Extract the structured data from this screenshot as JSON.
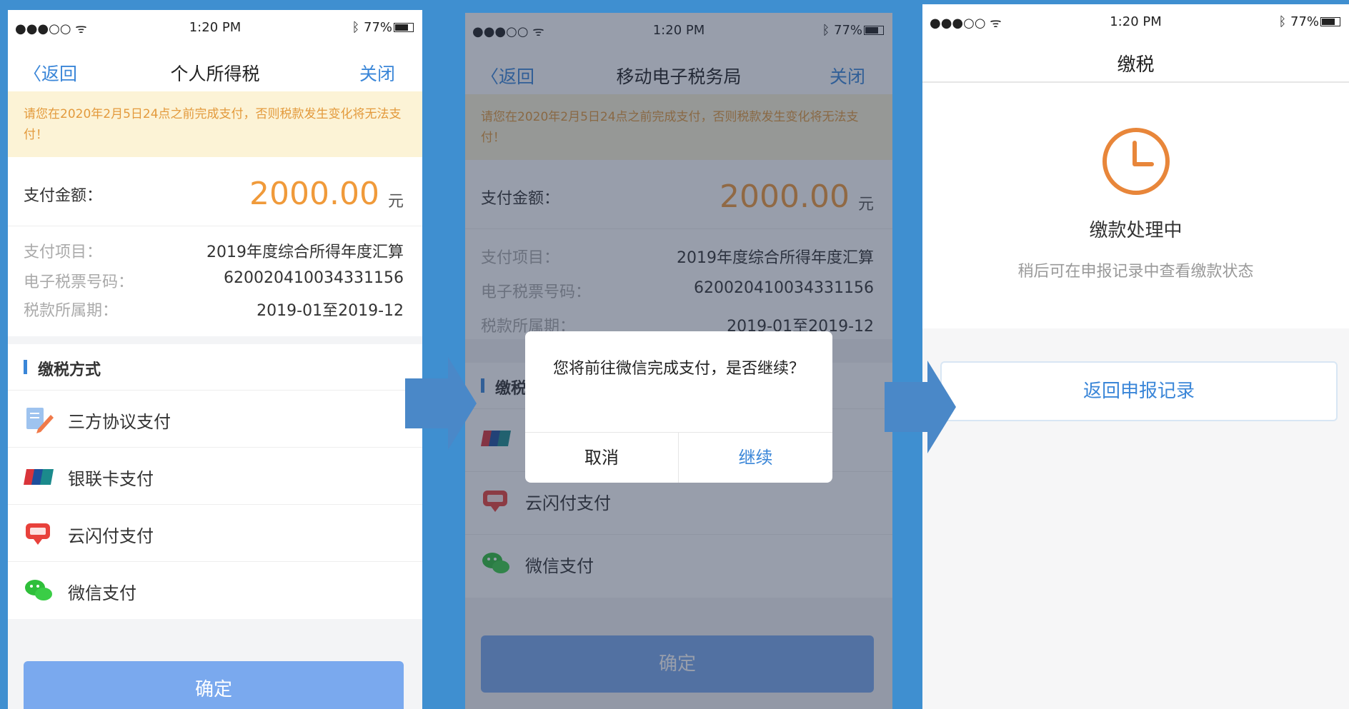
{
  "status": {
    "signal": "●●●○○ ᯤ",
    "time": "1:20 PM",
    "battery": "ᛒ 77%"
  },
  "screen1": {
    "back": "〈返回",
    "title": "个人所得税",
    "close": "关闭",
    "notice": "请您在2020年2月5日24点之前完成支付，否则税款发生变化将无法支付！",
    "amount_label": "支付金额：",
    "amount_value": "2000.00",
    "amount_unit": "元",
    "details": [
      {
        "k": "支付项目：",
        "v": "2019年度综合所得年度汇算"
      },
      {
        "k": "电子税票号码：",
        "v": "620020410034331156"
      },
      {
        "k": "税款所属期：",
        "v": "2019-01至2019-12"
      }
    ],
    "section": "缴税方式",
    "methods": [
      {
        "label": "三方协议支付",
        "icon": "pen-doc-icon"
      },
      {
        "label": "银联卡支付",
        "icon": "unionpay-card-icon"
      },
      {
        "label": "云闪付支付",
        "icon": "quickpass-icon"
      },
      {
        "label": "微信支付",
        "icon": "wechat-icon"
      }
    ],
    "confirm": "确定"
  },
  "screen2": {
    "back": "〈返回",
    "title": "移动电子税务局",
    "close": "关闭",
    "section_partial": "缴税",
    "dialog_message": "您将前往微信完成支付，是否继续？",
    "dialog_cancel": "取消",
    "dialog_ok": "继续"
  },
  "screen3": {
    "title": "缴税",
    "processing_title": "缴款处理中",
    "processing_subtitle": "稍后可在申报记录中查看缴款状态",
    "return_button": "返回申报记录"
  },
  "colors": {
    "accent": "#3a86d8",
    "amount": "#f09a3a",
    "notice_bg": "#fcf3d6",
    "background": "#3f8fd0"
  }
}
